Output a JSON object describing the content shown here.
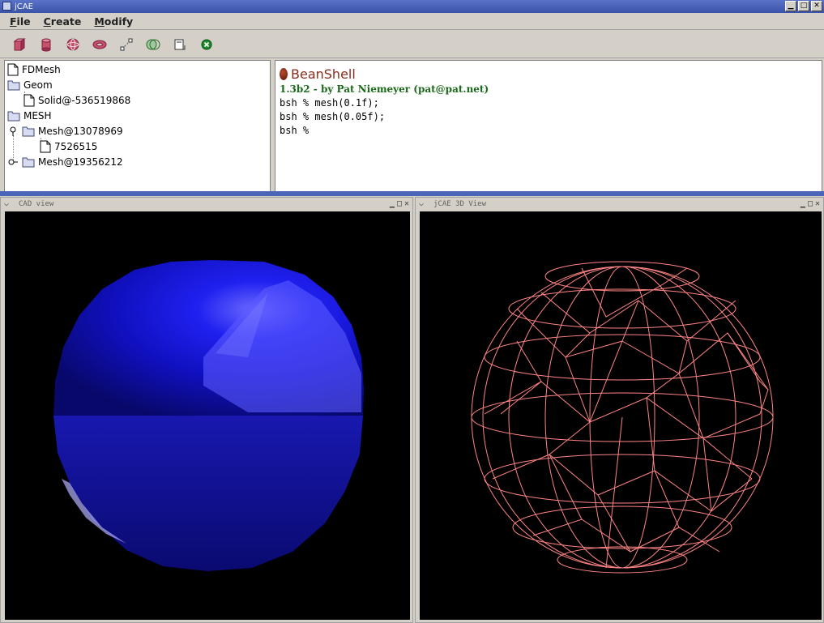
{
  "window": {
    "title": "jCAE",
    "buttons": {
      "minimize": "▁",
      "maximize": "□",
      "close": "✕"
    }
  },
  "menubar": {
    "items": [
      {
        "first": "F",
        "rest": "ile"
      },
      {
        "first": "C",
        "rest": "reate"
      },
      {
        "first": "M",
        "rest": "odify"
      }
    ]
  },
  "toolbar": {
    "buttons": [
      "box-icon",
      "cylinder-icon",
      "sphere-icon",
      "torus-icon",
      "points-icon",
      "boolean-icon",
      "export-icon",
      "close-green-icon"
    ]
  },
  "tree": {
    "items": [
      {
        "label": "FDMesh"
      },
      {
        "label": "Geom"
      },
      {
        "label": "Solid@-536519868"
      },
      {
        "label": "MESH"
      },
      {
        "label": "Mesh@13078969"
      },
      {
        "label": "7526515"
      },
      {
        "label": "Mesh@19356212"
      }
    ]
  },
  "console": {
    "title": "BeanShell",
    "subtitle": "1.3b2 - by Pat Niemeyer (pat@pat.net)",
    "lines": [
      "bsh % mesh(0.1f);",
      "bsh % mesh(0.05f);",
      "bsh %"
    ]
  },
  "frames": {
    "cad": {
      "title": "CAD view"
    },
    "view3d": {
      "title": "jCAE 3D View"
    }
  },
  "colors": {
    "sphere": "#1a1af0",
    "wireframe": "#ff8080",
    "background": "#000000"
  }
}
